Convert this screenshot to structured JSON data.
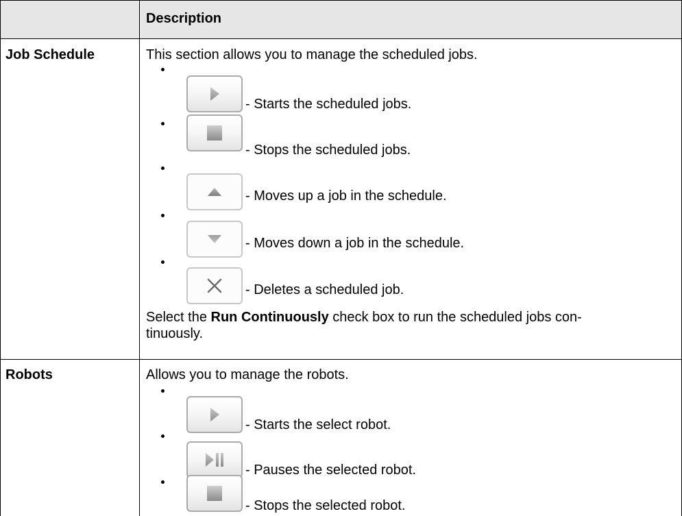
{
  "table": {
    "header": {
      "col1": "",
      "col2": "Description"
    },
    "job_schedule": {
      "label": "Job Schedule",
      "intro": "This section allows you to manage the scheduled jobs.",
      "items": [
        {
          "icon": "play-icon",
          "text": "- Starts the scheduled jobs."
        },
        {
          "icon": "stop-icon",
          "text": "- Stops the scheduled jobs."
        },
        {
          "icon": "move-up-icon",
          "text": "- Moves up a job in the schedule."
        },
        {
          "icon": "move-down-icon",
          "text": "- Moves down a job in the schedule."
        },
        {
          "icon": "delete-icon",
          "text": "- Deletes a scheduled job."
        }
      ],
      "note_prefix": "Select the ",
      "note_bold": "Run Continuously",
      "note_suffix": " check box to run the scheduled jobs con-",
      "note_line2": "tinuously."
    },
    "robots": {
      "label": "Robots",
      "intro": "Allows you to manage the robots.",
      "items": [
        {
          "icon": "play-icon",
          "text": "- Starts the select robot."
        },
        {
          "icon": "pause-icon",
          "text": "- Pauses the selected robot."
        },
        {
          "icon": "stop-icon",
          "text": "- Stops the selected robot."
        }
      ]
    }
  }
}
